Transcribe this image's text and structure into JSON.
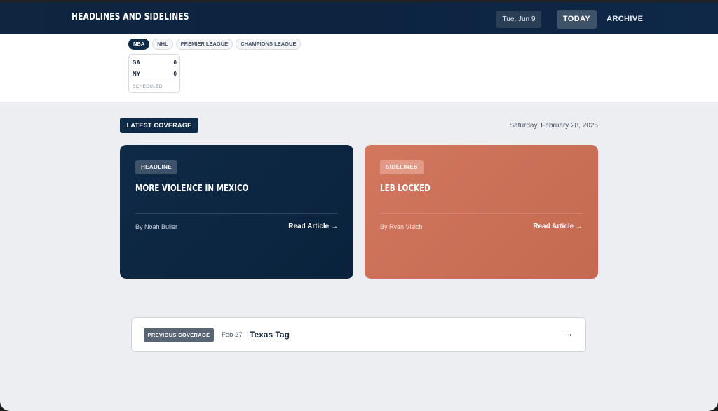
{
  "header": {
    "brand": "Headlines and Sidelines",
    "date": "Tue, Jun 9",
    "nav": {
      "today": "TODAY",
      "archive": "ARCHIVE"
    }
  },
  "scores": {
    "leagues": [
      "NBA",
      "NHL",
      "PREMIER LEAGUE",
      "CHAMPIONS LEAGUE"
    ],
    "active_league": "NBA",
    "game": {
      "team1": {
        "abbr": "SA",
        "score": "0"
      },
      "team2": {
        "abbr": "NY",
        "score": "0"
      },
      "status": "SCHEDULED"
    }
  },
  "main": {
    "section_label": "LATEST COVERAGE",
    "date": "Saturday, February 28, 2026",
    "stories": [
      {
        "tag": "HEADLINE",
        "title": "More Violence in Mexico",
        "byline": "By Noah Buller",
        "link": "Read Article →"
      },
      {
        "tag": "SIDELINES",
        "title": "Leb Locked",
        "byline": "By Ryan Visich",
        "link": "Read Article →"
      }
    ],
    "previous": {
      "label": "PREVIOUS COVERAGE",
      "date": "Feb 27",
      "title": "Texas Tag",
      "arrow": "→"
    }
  },
  "colors": {
    "navy": "#0e2a47",
    "coral": "#d3775f",
    "page_bg": "#eceef1"
  }
}
